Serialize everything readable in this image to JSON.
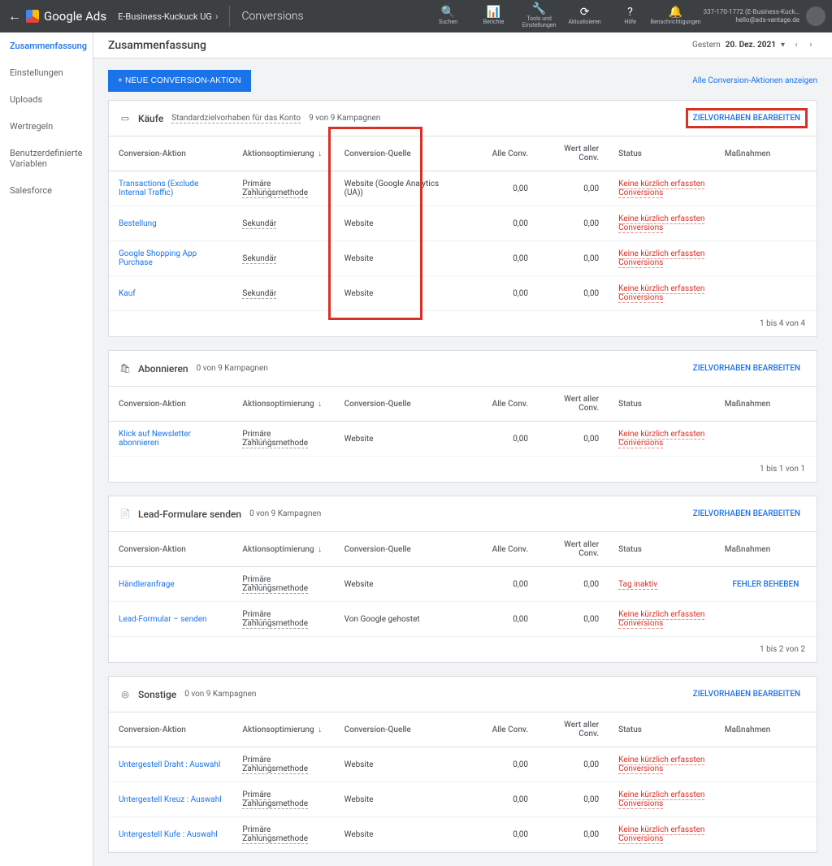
{
  "topbar": {
    "product": "Google Ads",
    "account_name": "E-Business-Kuckuck UG",
    "breadcrumb": "Conversions",
    "actions": {
      "search": "Suchen",
      "reports": "Berichte",
      "tools": "Tools und Einstellungen",
      "refresh": "Aktualisieren",
      "help": "Hilfe",
      "notifications": "Benachrichtigungen"
    },
    "account_id": "337-170-1772 (E-Business-Kuck…",
    "account_email": "hello@ads-vantage.de"
  },
  "sidenav": [
    "Zusammenfassung",
    "Einstellungen",
    "Uploads",
    "Wertregeln",
    "Benutzerdefinierte Variablen",
    "Salesforce"
  ],
  "page": {
    "title": "Zusammenfassung",
    "date_label": "Gestern",
    "date_value": "20. Dez. 2021",
    "new_button": "+ NEUE CONVERSION-AKTION",
    "link_all": "Alle Conversion-Aktionen anzeigen"
  },
  "columns": {
    "action": "Conversion-Aktion",
    "opt": "Aktionsoptimierung",
    "source": "Conversion-Quelle",
    "all": "Alle Conv.",
    "val": "Wert aller Conv.",
    "status": "Status",
    "measures": "Maßnahmen"
  },
  "labels": {
    "edit_goals": "ZIELVORHABEN BEARBEITEN",
    "standard_default": "Standardzielvorhaben für das Konto",
    "fix_error": "FEHLER BEHEBEN"
  },
  "status": {
    "no_recent": "Keine kürzlich erfassten Conversions",
    "tag_inactive": "Tag inaktiv"
  },
  "opt_values": {
    "primary": "Primäre Zahlungsmethode",
    "secondary": "Sekundär"
  },
  "sources": {
    "ga": "Website (Google Analytics (UA))",
    "web": "Website",
    "google_hosted": "Von Google gehostet"
  },
  "sections": [
    {
      "icon": "card",
      "title": "Käufe",
      "show_default": true,
      "campaigns": "9 von 9 Kampagnen",
      "highlight_button": true,
      "highlight_column": true,
      "rows": [
        {
          "name": "Transactions (Exclude Internal Traffic)",
          "opt": "primary",
          "source": "ga",
          "status": "no_recent"
        },
        {
          "name": "Bestellung",
          "opt": "secondary",
          "source": "web",
          "status": "no_recent"
        },
        {
          "name": "Google Shopping App Purchase",
          "opt": "secondary",
          "source": "web",
          "status": "no_recent"
        },
        {
          "name": "Kauf",
          "opt": "secondary",
          "source": "web",
          "status": "no_recent"
        }
      ],
      "paging": "1 bis 4 von 4"
    },
    {
      "icon": "cart",
      "title": "Abonnieren",
      "campaigns": "0 von 9 Kampagnen",
      "rows": [
        {
          "name": "Klick auf Newsletter abonnieren",
          "opt": "primary",
          "source": "web",
          "status": "no_recent"
        }
      ],
      "paging": "1 bis 1 von 1"
    },
    {
      "icon": "form",
      "title": "Lead-Formulare senden",
      "campaigns": "0 von 9 Kampagnen",
      "rows": [
        {
          "name": "Händleranfrage",
          "opt": "primary",
          "source": "web",
          "status": "tag_inactive",
          "fix": true
        },
        {
          "name": "Lead-Formular – senden",
          "opt": "primary",
          "source": "google_hosted",
          "status": "no_recent"
        }
      ],
      "paging": "1 bis 2 von 2"
    },
    {
      "icon": "other",
      "title": "Sonstige",
      "campaigns": "0 von 9 Kampagnen",
      "rows": [
        {
          "name": "Untergestell Draht : Auswahl",
          "opt": "primary",
          "source": "web",
          "status": "no_recent"
        },
        {
          "name": "Untergestell Kreuz : Auswahl",
          "opt": "primary",
          "source": "web",
          "status": "no_recent"
        },
        {
          "name": "Untergestell Kufe : Auswahl",
          "opt": "primary",
          "source": "web",
          "status": "no_recent"
        }
      ],
      "paging": ""
    }
  ],
  "zero": "0,00"
}
